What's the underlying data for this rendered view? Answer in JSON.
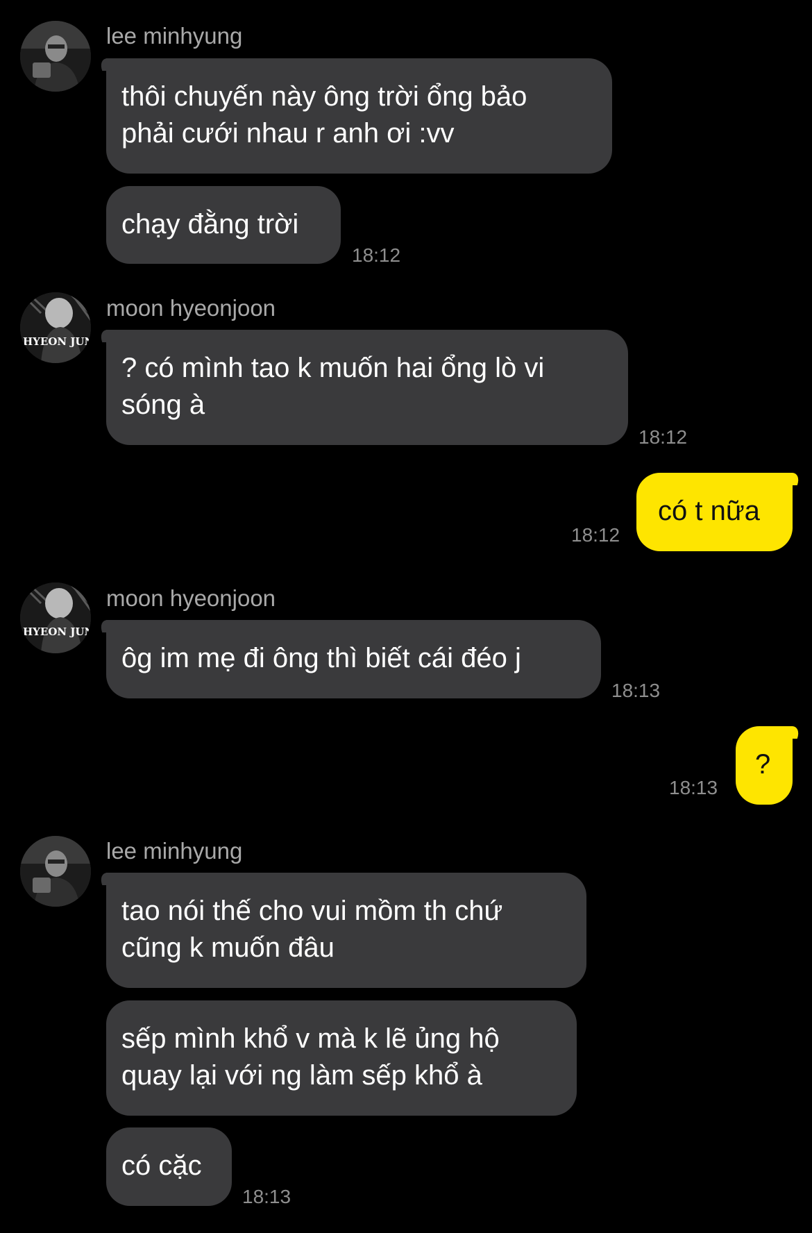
{
  "colors": {
    "background": "#000000",
    "incoming_bubble": "#3a3a3c",
    "outgoing_bubble": "#fee500",
    "sender_name": "#a9a9a9",
    "timestamp": "#8e8e8e"
  },
  "messages": {
    "g1": {
      "sender": "lee minhyung",
      "m1": "thôi chuyến này ông trời ổng bảo\nphải cưới nhau r anh ơi :vv",
      "m2": "chạy đằng trời",
      "time": "18:12"
    },
    "g2": {
      "sender": "moon hyeonjoon",
      "m1": "? có mình tao k muốn hai ổng lò vi\nsóng à",
      "time": "18:12"
    },
    "g3": {
      "m1": "có t nữa",
      "time": "18:12"
    },
    "g4": {
      "sender": "moon hyeonjoon",
      "m1": "ôg im mẹ đi ông thì biết cái đéo j",
      "time": "18:13"
    },
    "g5": {
      "m1": "?",
      "time": "18:13"
    },
    "g6": {
      "sender": "lee minhyung",
      "m1": "tao nói thế cho vui mồm th chứ\ncũng k muốn đâu",
      "m2": "sếp mình khổ v mà k lẽ ủng hộ\nquay lại với ng làm sếp khổ à",
      "m3": "có cặc",
      "time": "18:13"
    }
  },
  "avatars": {
    "moon_caption": "HYEON JUN"
  }
}
